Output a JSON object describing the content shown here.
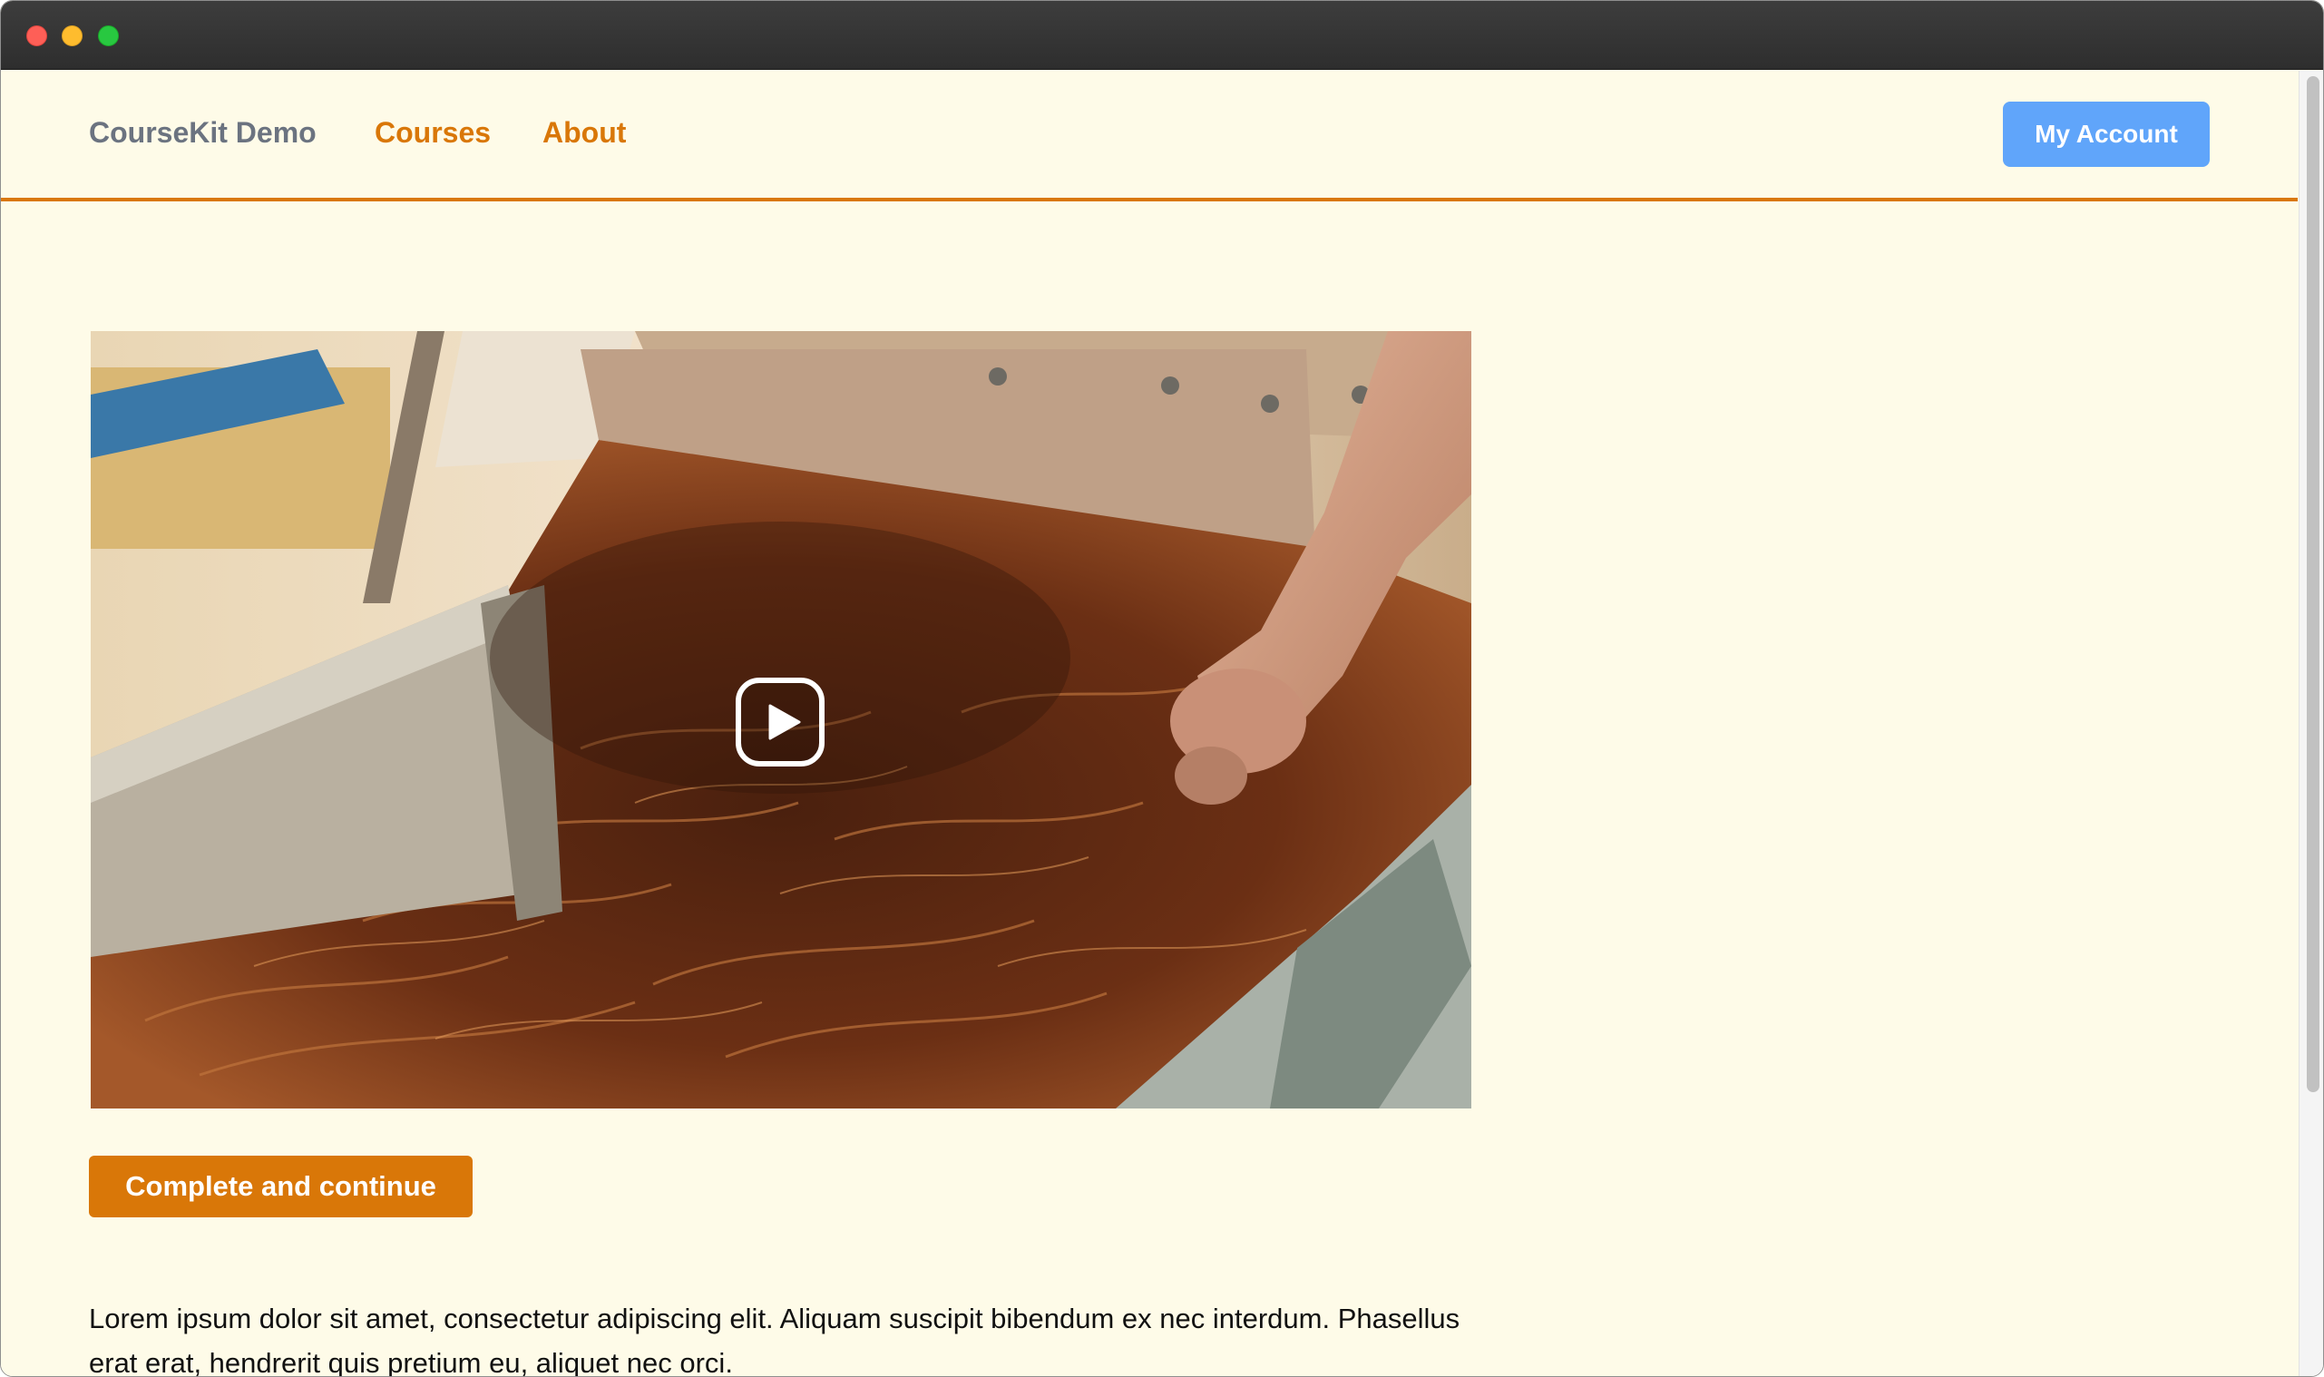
{
  "window": {
    "controls": [
      "close",
      "minimize",
      "zoom"
    ]
  },
  "navbar": {
    "brand": "CourseKit Demo",
    "links": [
      {
        "label": "Courses"
      },
      {
        "label": "About"
      }
    ],
    "account_button": "My Account"
  },
  "video": {
    "play_icon": "play-icon"
  },
  "lesson": {
    "cta_label": "Complete and continue",
    "body": "Lorem ipsum dolor sit amet, consectetur adipiscing elit. Aliquam suscipit bibendum ex nec interdum. Phasellus erat erat, hendrerit quis pretium eu, aliquet nec orci."
  },
  "colors": {
    "page_background": "#fefbe8",
    "accent": "#d97708",
    "account_button": "#60a5fa",
    "brand_text": "#6b7380"
  }
}
